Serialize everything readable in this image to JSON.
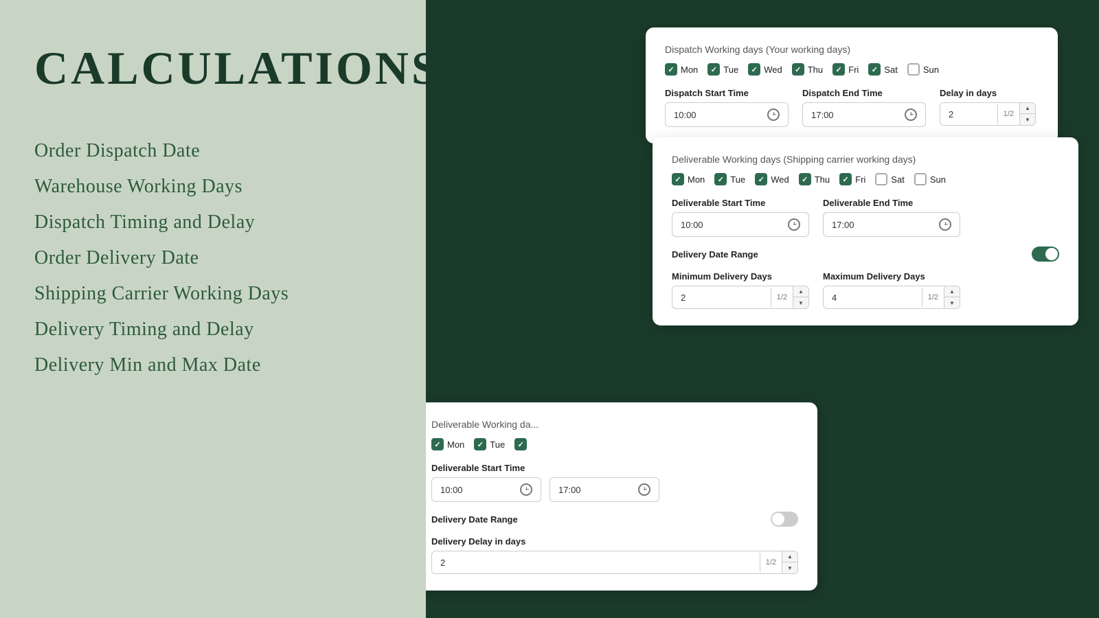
{
  "title": "Calculations",
  "menu": {
    "items": [
      "Order Dispatch Date",
      "Warehouse Working Days",
      "Dispatch Timing and Delay",
      "Order Delivery Date",
      "Shipping Carrier Working Days",
      "Delivery Timing and Delay",
      "Delivery Min and Max Date"
    ]
  },
  "card_dispatch": {
    "title": "Dispatch Working days",
    "subtitle": "(Your working days)",
    "days": [
      {
        "label": "Mon",
        "checked": true
      },
      {
        "label": "Tue",
        "checked": true
      },
      {
        "label": "Wed",
        "checked": true
      },
      {
        "label": "Thu",
        "checked": true
      },
      {
        "label": "Fri",
        "checked": true
      },
      {
        "label": "Sat",
        "checked": true
      },
      {
        "label": "Sun",
        "checked": false
      }
    ],
    "start_time_label": "Dispatch Start Time",
    "start_time_value": "10:00",
    "end_time_label": "Dispatch End Time",
    "end_time_value": "17:00",
    "delay_label": "Delay in days",
    "delay_value": "2",
    "delay_fraction": "1/2"
  },
  "card_deliverable": {
    "title": "Deliverable Working days",
    "subtitle": "(Shipping carrier working days)",
    "days": [
      {
        "label": "Mon",
        "checked": true
      },
      {
        "label": "Tue",
        "checked": true
      },
      {
        "label": "Wed",
        "checked": true
      },
      {
        "label": "Thu",
        "checked": true
      },
      {
        "label": "Fri",
        "checked": true
      },
      {
        "label": "Sat",
        "checked": false
      },
      {
        "label": "Sun",
        "checked": false
      }
    ],
    "start_time_label": "Deliverable Start Time",
    "start_time_value": "10:00",
    "end_time_label": "Deliverable End Time",
    "end_time_value": "17:00",
    "delivery_date_range_label": "Delivery Date Range",
    "toggle_on": true,
    "min_delivery_label": "Minimum Delivery Days",
    "min_delivery_value": "2",
    "min_delivery_fraction": "1/2",
    "max_delivery_label": "Maximum Delivery Days",
    "max_delivery_value": "4",
    "max_delivery_fraction": "1/2"
  },
  "card_partial": {
    "title": "Deliverable Working da...",
    "days_visible": [
      {
        "label": "Mon",
        "checked": true
      },
      {
        "label": "Tue",
        "checked": true
      }
    ],
    "start_time_label": "Deliverable Start Time",
    "start_time_value": "10:00",
    "end_time_value_partial": "17:00",
    "delivery_date_range_label": "Delivery Date Range",
    "delivery_delay_label": "Delivery Delay in days",
    "delivery_delay_value": "2",
    "delivery_delay_fraction": "1/2"
  }
}
